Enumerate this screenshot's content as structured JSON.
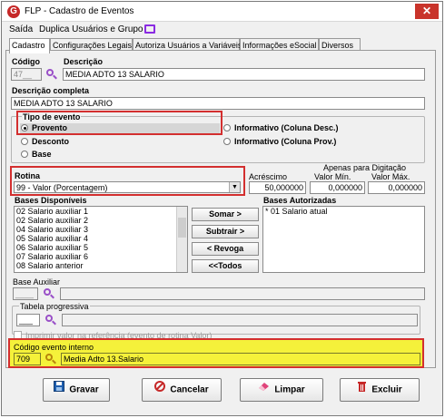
{
  "window": {
    "title": "FLP - Cadastro de Eventos",
    "close_label": "✕"
  },
  "menu": {
    "items": [
      "Saída",
      "Duplica Usuários e Grupo"
    ]
  },
  "tabs": [
    "Cadastro",
    "Configurações Legais",
    "Autoriza Usuários a Variáveis",
    "Informações eSocial",
    "Diversos"
  ],
  "form": {
    "codigo_label": "Código",
    "codigo_value": "47__",
    "descricao_label": "Descrição",
    "descricao_value": "MEDIA ADTO 13 SALARIO",
    "descricao_completa_label": "Descrição completa",
    "descricao_completa_value": "MEDIA ADTO 13 SALARIO",
    "tipo_evento_label": "Tipo de evento",
    "tipo_options": [
      {
        "label": "Provento",
        "selected": true
      },
      {
        "label": "Desconto",
        "selected": false
      },
      {
        "label": "Base",
        "selected": false
      },
      {
        "label": "Informativo (Coluna Desc.)",
        "selected": false
      },
      {
        "label": "Informativo (Coluna Prov.)",
        "selected": false
      }
    ],
    "rotina_label": "Rotina",
    "rotina_value": "99 - Valor (Porcentagem)",
    "acrescimo_label": "Acréscimo",
    "acrescimo_value": "50,000000",
    "apenas_label": "Apenas para Digitação",
    "valor_min_label": "Valor Mín.",
    "valor_min_value": "0,000000",
    "valor_max_label": "Valor Máx.",
    "valor_max_value": "0,000000",
    "bases_disponiveis_label": "Bases Disponíveis",
    "bases_disponiveis": [
      "02 Salario auxiliar 1",
      "02 Salario auxiliar 2",
      "04 Salario auxiliar 3",
      "05 Salario auxiliar 4",
      "06 Salario auxiliar 5",
      "07 Salario auxiliar 6",
      "08 Salario anterior"
    ],
    "bases_autorizadas_label": "Bases Autorizadas",
    "bases_autorizadas": [
      "* 01 Salario atual"
    ],
    "buttons": {
      "somar": "Somar >",
      "subtrair": "Subtrair >",
      "revoga": "< Revoga",
      "todos": "<<Todos"
    },
    "base_auxiliar_label": "Base Auxiliar",
    "base_auxiliar_value": "____",
    "tabela_progressiva_label": "Tabela progressiva",
    "tabela_progressiva_value": "___",
    "imprimir_label": "Imprimir valor na referência (evento de rotina Valor)",
    "codigo_interno_label": "Código evento interno",
    "codigo_interno_value": "709",
    "codigo_interno_desc": "Media Adto 13.Salario"
  },
  "actions": {
    "gravar": "Gravar",
    "cancelar": "Cancelar",
    "limpar": "Limpar",
    "excluir": "Excluir"
  },
  "colors": {
    "highlight": "#d32f2f",
    "yellow": "#f5f13a",
    "accent": "#9a50c8"
  }
}
